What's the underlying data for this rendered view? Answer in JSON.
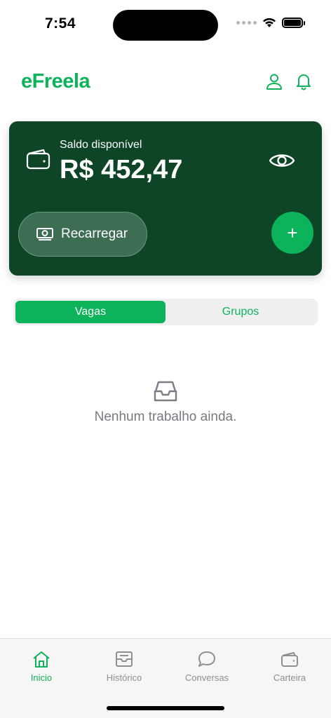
{
  "status": {
    "time": "7:54"
  },
  "header": {
    "logo": "eFreela",
    "profile_icon": "user-icon",
    "notifications_icon": "bell-icon"
  },
  "balance": {
    "label": "Saldo disponível",
    "value": "R$ 452,47",
    "recharge_label": "Recarregar",
    "add_symbol": "+"
  },
  "segments": [
    {
      "label": "Vagas",
      "active": true
    },
    {
      "label": "Grupos",
      "active": false
    }
  ],
  "empty": {
    "message": "Nenhum trabalho ainda."
  },
  "tabs": [
    {
      "label": "Inicio",
      "icon": "home-icon",
      "active": true
    },
    {
      "label": "Histórico",
      "icon": "inbox-icon",
      "active": false
    },
    {
      "label": "Conversas",
      "icon": "chat-icon",
      "active": false
    },
    {
      "label": "Carteira",
      "icon": "wallet-icon",
      "active": false
    }
  ],
  "colors": {
    "brand": "#0db35a",
    "card": "#0f4527",
    "muted": "#8e8e93"
  }
}
